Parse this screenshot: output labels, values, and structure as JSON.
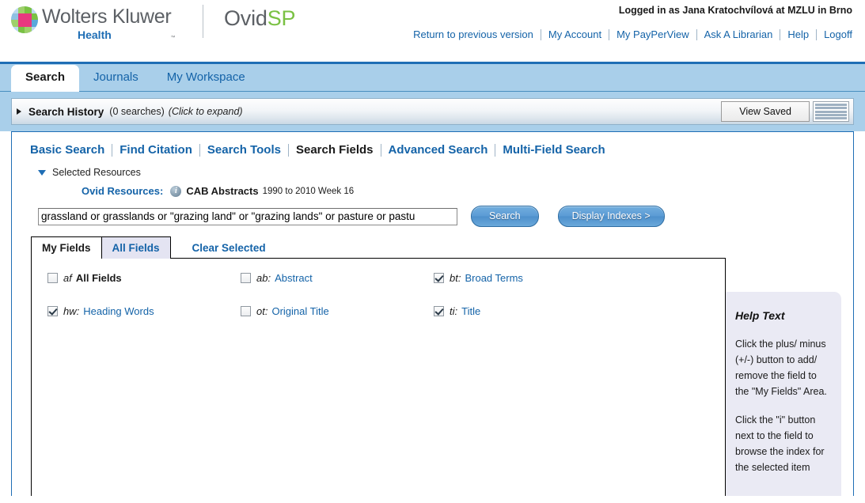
{
  "header": {
    "brand_name": "Wolters Kluwer",
    "brand_sub": "Health",
    "trademark": "™",
    "product_main": "Ovid",
    "product_accent": "SP",
    "logged_in": "Logged in as Jana Kratochvílová at MZLU in Brno",
    "links": [
      "Return to previous version",
      "My Account",
      "My PayPerView",
      "Ask A Librarian",
      "Help",
      "Logoff"
    ]
  },
  "tabs": [
    {
      "label": "Search",
      "active": true
    },
    {
      "label": "Journals",
      "active": false
    },
    {
      "label": "My Workspace",
      "active": false
    }
  ],
  "search_history": {
    "title": "Search History",
    "count": "(0 searches)",
    "hint": "(Click to expand)",
    "view_saved_label": "View Saved",
    "stripes_icon": "list-stripes-icon",
    "expand_icon": "triangle-right-icon"
  },
  "subtabs": [
    {
      "label": "Basic Search",
      "current": false
    },
    {
      "label": "Find Citation",
      "current": false
    },
    {
      "label": "Search Tools",
      "current": false
    },
    {
      "label": "Search Fields",
      "current": true
    },
    {
      "label": "Advanced Search",
      "current": false
    },
    {
      "label": "Multi-Field Search",
      "current": false
    }
  ],
  "resources": {
    "section_label": "Selected Resources",
    "collapse_icon": "triangle-down-icon",
    "ovid_label": "Ovid Resources:",
    "info_icon": "info-icon",
    "database": "CAB Abstracts",
    "coverage": "1990 to 2010 Week 16"
  },
  "search": {
    "query": "grassland or grasslands or \"grazing land\" or \"grazing lands\" or pasture or pastu",
    "placeholder": "",
    "search_button": "Search",
    "display_indexes_button": "Display Indexes >"
  },
  "field_tabs": [
    {
      "label": "My Fields",
      "active": true
    },
    {
      "label": "All Fields",
      "active": false
    }
  ],
  "clear_selected": "Clear Selected",
  "fields": [
    {
      "code": "af",
      "label": "All Fields",
      "checked": false,
      "link": false
    },
    {
      "code": "ab:",
      "label": "Abstract",
      "checked": false,
      "link": true
    },
    {
      "code": "bt:",
      "label": "Broad Terms",
      "checked": true,
      "link": true
    },
    {
      "code": "hw:",
      "label": "Heading Words",
      "checked": true,
      "link": true
    },
    {
      "code": "ot:",
      "label": "Original Title",
      "checked": false,
      "link": true
    },
    {
      "code": "ti:",
      "label": "Title",
      "checked": true,
      "link": true
    }
  ],
  "help": {
    "title": "Help Text",
    "paragraph1": "Click the plus/ minus (+/-) button to add/ remove the field to the \"My Fields\" Area.",
    "paragraph2": "Click the \"i\" button next to the field to browse the index for the selected item"
  },
  "colors": {
    "brand_blue": "#1f6eb5",
    "link_blue": "#1463a8",
    "tabbar_blue": "#a9cfea",
    "accent_green": "#7ac143",
    "help_bg": "#eaeaf4",
    "button_blue": "#5b9bd5"
  }
}
